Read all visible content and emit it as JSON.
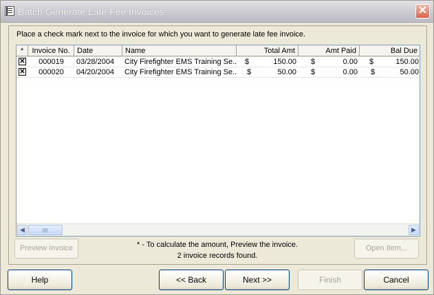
{
  "window": {
    "title": "Batch Generate Late Fee Invoices"
  },
  "instruction": "Place a check mark next to the invoice for which you want to generate late fee invoice.",
  "table": {
    "columns": [
      "*",
      "Invoice No.",
      "Date",
      "Name",
      "Total Amt",
      "Amt Paid",
      "Bal Due"
    ],
    "rows": [
      {
        "checked": "✕",
        "invoice_no": "000019",
        "date": "03/28/2004",
        "name": "City Firefighter EMS Training Se...",
        "total_sym": "$",
        "total": "150.00",
        "paid_sym": "$",
        "paid": "0.00",
        "bal_sym": "$",
        "bal": "150.00"
      },
      {
        "checked": "✕",
        "invoice_no": "000020",
        "date": "04/20/2004",
        "name": "City Firefighter EMS Training Se...",
        "total_sym": "$",
        "total": "50.00",
        "paid_sym": "$",
        "paid": "0.00",
        "bal_sym": "$",
        "bal": "50.00"
      }
    ]
  },
  "footnote": {
    "line1": "* - To calculate the amount, Preview the invoice.",
    "line2": "2 invoice records found."
  },
  "buttons": {
    "preview": "Preview Invoice",
    "open": "Open Item...",
    "help": "Help",
    "back": "<< Back",
    "next": "Next >>",
    "finish": "Finish",
    "cancel": "Cancel"
  },
  "icons": {
    "title": "app-document-icon",
    "close": "close-icon"
  },
  "colors": {
    "close": "#d9644b",
    "grid_border": "#7f9db9",
    "dialog_bg": "#ece9d8"
  }
}
